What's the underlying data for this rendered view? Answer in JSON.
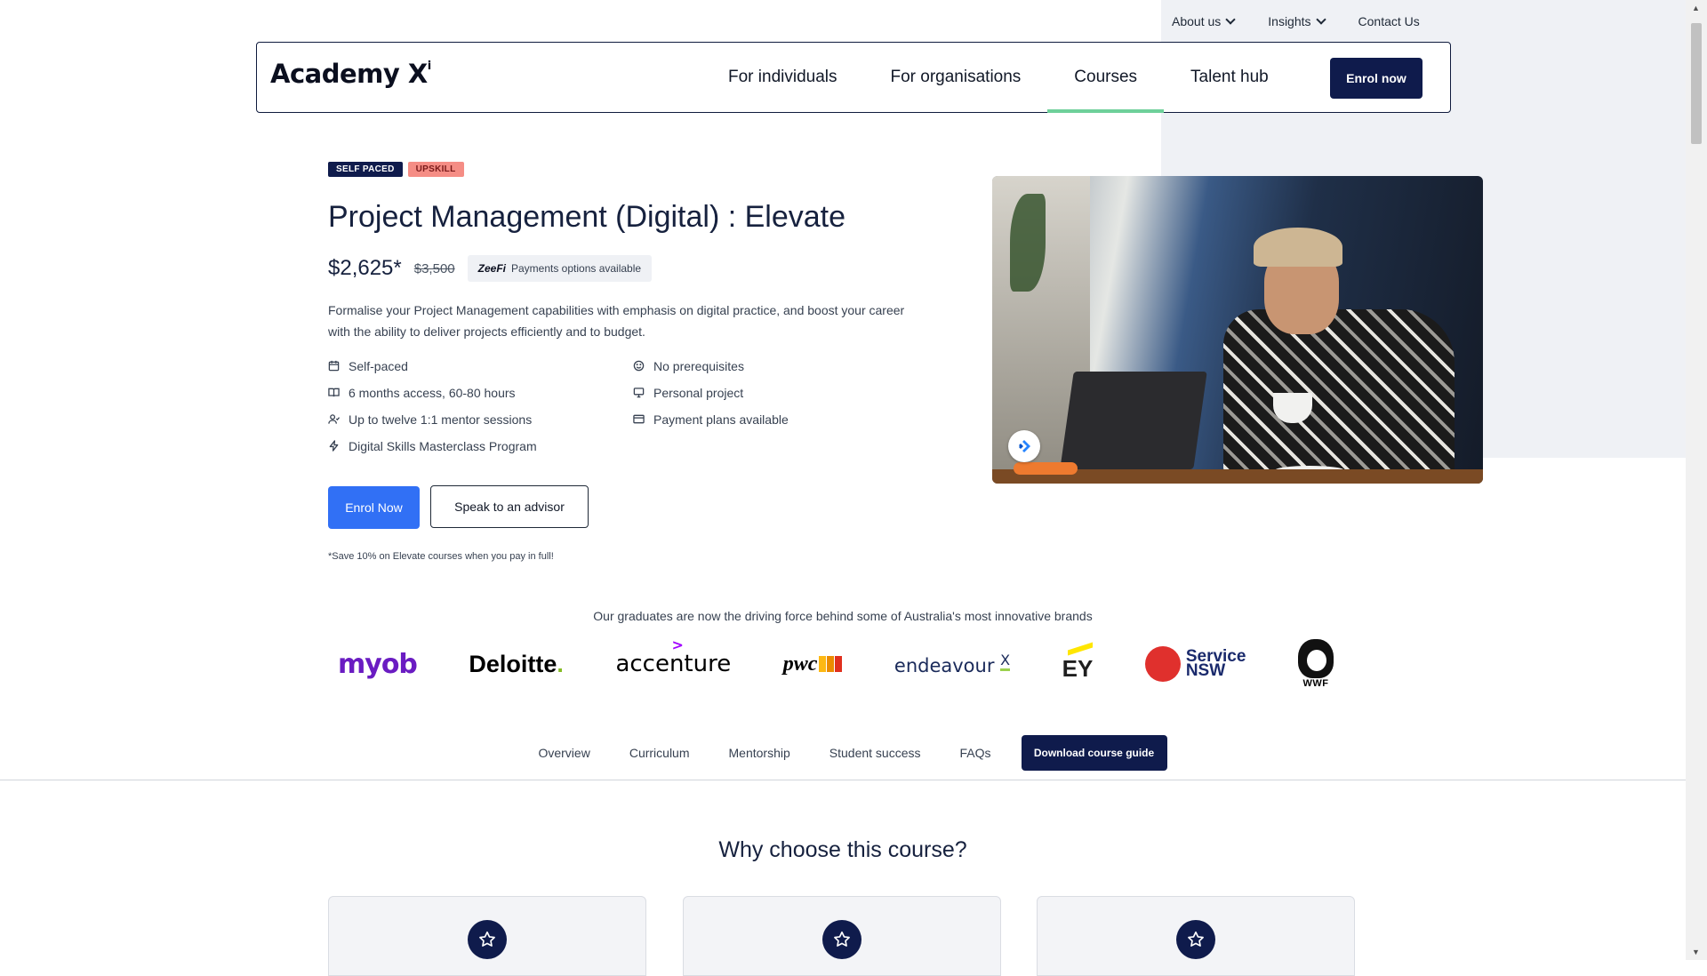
{
  "topnav": {
    "items": [
      {
        "label": "About us",
        "has_dropdown": true
      },
      {
        "label": "Insights",
        "has_dropdown": true
      },
      {
        "label": "Contact Us",
        "has_dropdown": false
      }
    ]
  },
  "header": {
    "logo_text": "Academy X",
    "logo_sup": "i",
    "nav": [
      "For individuals",
      "For organisations",
      "Courses",
      "Talent hub"
    ],
    "active_nav": "Courses",
    "enrol_label": "Enrol now"
  },
  "course": {
    "tags": [
      "SELF PACED",
      "UPSKILL"
    ],
    "title": "Project Management (Digital) : Elevate",
    "price": "$2,625*",
    "old_price": "$3,500",
    "payment_badge_brand": "ZeeFi",
    "payment_badge_text": "Payments options available",
    "description": "Formalise your Project Management capabilities with emphasis on digital practice, and boost your career with the ability to deliver projects efficiently and to budget.",
    "features": [
      {
        "icon": "calendar-icon",
        "label": "Self-paced"
      },
      {
        "icon": "smiley-icon",
        "label": "No prerequisites"
      },
      {
        "icon": "book-icon",
        "label": "6 months access, 60-80 hours"
      },
      {
        "icon": "monitor-icon",
        "label": "Personal project"
      },
      {
        "icon": "mentor-icon",
        "label": "Up to twelve 1:1 mentor sessions"
      },
      {
        "icon": "credit-card-icon",
        "label": "Payment plans available"
      },
      {
        "icon": "lightning-icon",
        "label": "Digital Skills Masterclass Program"
      }
    ],
    "enrol_button": "Enrol Now",
    "advisor_button": "Speak to an advisor",
    "note": "*Save 10% on Elevate courses when you pay in full!"
  },
  "brands": {
    "heading": "Our graduates are now the driving force behind some of Australia's most innovative brands",
    "logos": {
      "myob": "myob",
      "deloitte": "Deloitte",
      "deloitte_dot": ".",
      "accenture": "accenture",
      "accenture_mark": ">",
      "pwc": "pwc",
      "endeavour": "endeavour",
      "endeavour_x": "X",
      "ey": "EY",
      "nsw_line1": "Service",
      "nsw_line2": "NSW",
      "wwf": "WWF"
    },
    "colors": {
      "myob": "#6a1cc2",
      "deloitte_dot": "#86bc25",
      "accenture_mark": "#a100ff",
      "ey_bar": "#ffe600",
      "nsw_red": "#e0302d",
      "nsw_blue": "#1a2a6c",
      "endeavour_underline": "#9bd14e"
    }
  },
  "tabs": {
    "items": [
      "Overview",
      "Curriculum",
      "Mentorship",
      "Student success",
      "FAQs"
    ],
    "cta": "Download course guide"
  },
  "why": {
    "title": "Why choose this course?",
    "card_icon": "star-icon"
  },
  "colors": {
    "navy": "#0f1b4c",
    "primary_blue": "#3170f5",
    "active_underline": "#6ed09a",
    "tag_pink": "#f58d85",
    "panel_bg": "#eff1f5"
  }
}
